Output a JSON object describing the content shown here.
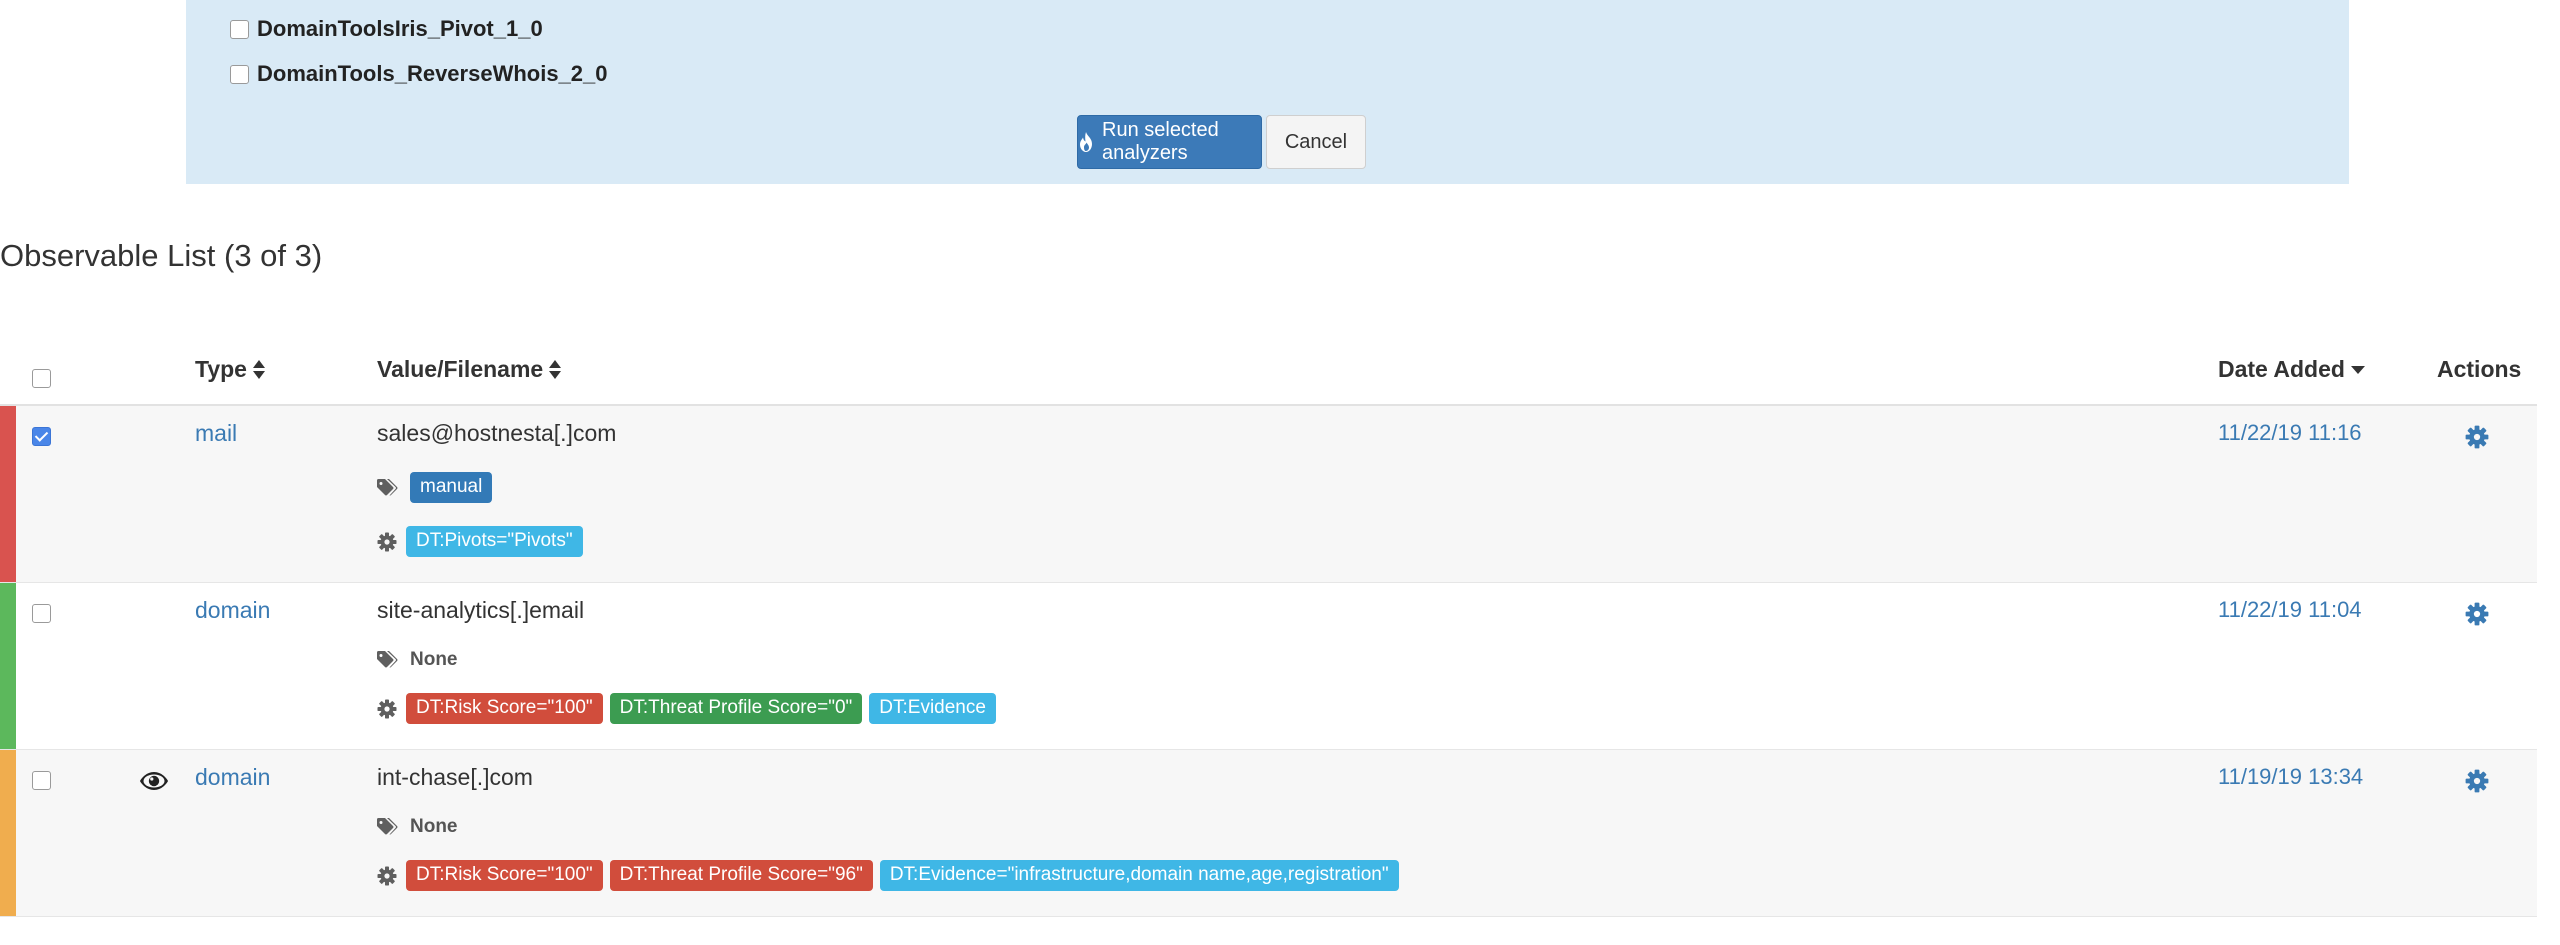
{
  "analyzers_panel": {
    "items": [
      {
        "label": "DomainToolsIris_Pivot_1_0",
        "checked": false
      },
      {
        "label": "DomainTools_ReverseWhois_2_0",
        "checked": false
      }
    ],
    "run_button": "Run selected analyzers",
    "cancel_button": "Cancel"
  },
  "observable_list": {
    "title": "Observable List (3 of 3)",
    "columns": {
      "type": "Type",
      "value": "Value/Filename",
      "date_added": "Date Added",
      "actions": "Actions"
    },
    "rows": [
      {
        "checked": true,
        "stripe_color": "#d9534f",
        "watched": false,
        "type": "mail",
        "value": "sales@hostnesta[.]com",
        "tags": [
          "manual"
        ],
        "reports": [
          {
            "text": "DT:Pivots=\"Pivots\"",
            "color": "info"
          }
        ],
        "date": "11/22/19 11:16"
      },
      {
        "checked": false,
        "stripe_color": "#5cb85c",
        "watched": false,
        "type": "domain",
        "value": "site-analytics[.]email",
        "tags_empty": "None",
        "reports": [
          {
            "text": "DT:Risk Score=\"100\"",
            "color": "red"
          },
          {
            "text": "DT:Threat Profile Score=\"0\"",
            "color": "green"
          },
          {
            "text": "DT:Evidence",
            "color": "info"
          }
        ],
        "date": "11/22/19 11:04"
      },
      {
        "checked": false,
        "stripe_color": "#f0ad4e",
        "watched": true,
        "type": "domain",
        "value": "int-chase[.]com",
        "tags_empty": "None",
        "reports": [
          {
            "text": "DT:Risk Score=\"100\"",
            "color": "red"
          },
          {
            "text": "DT:Threat Profile Score=\"96\"",
            "color": "red"
          },
          {
            "text": "DT:Evidence=\"infrastructure,domain name,age,registration\"",
            "color": "info"
          }
        ],
        "date": "11/19/19 13:34"
      }
    ]
  },
  "icons": {
    "run": "fire-icon",
    "tags": "tags-icon",
    "reports": "gear-icon",
    "actions": "gear-icon",
    "watch": "eye-icon"
  }
}
